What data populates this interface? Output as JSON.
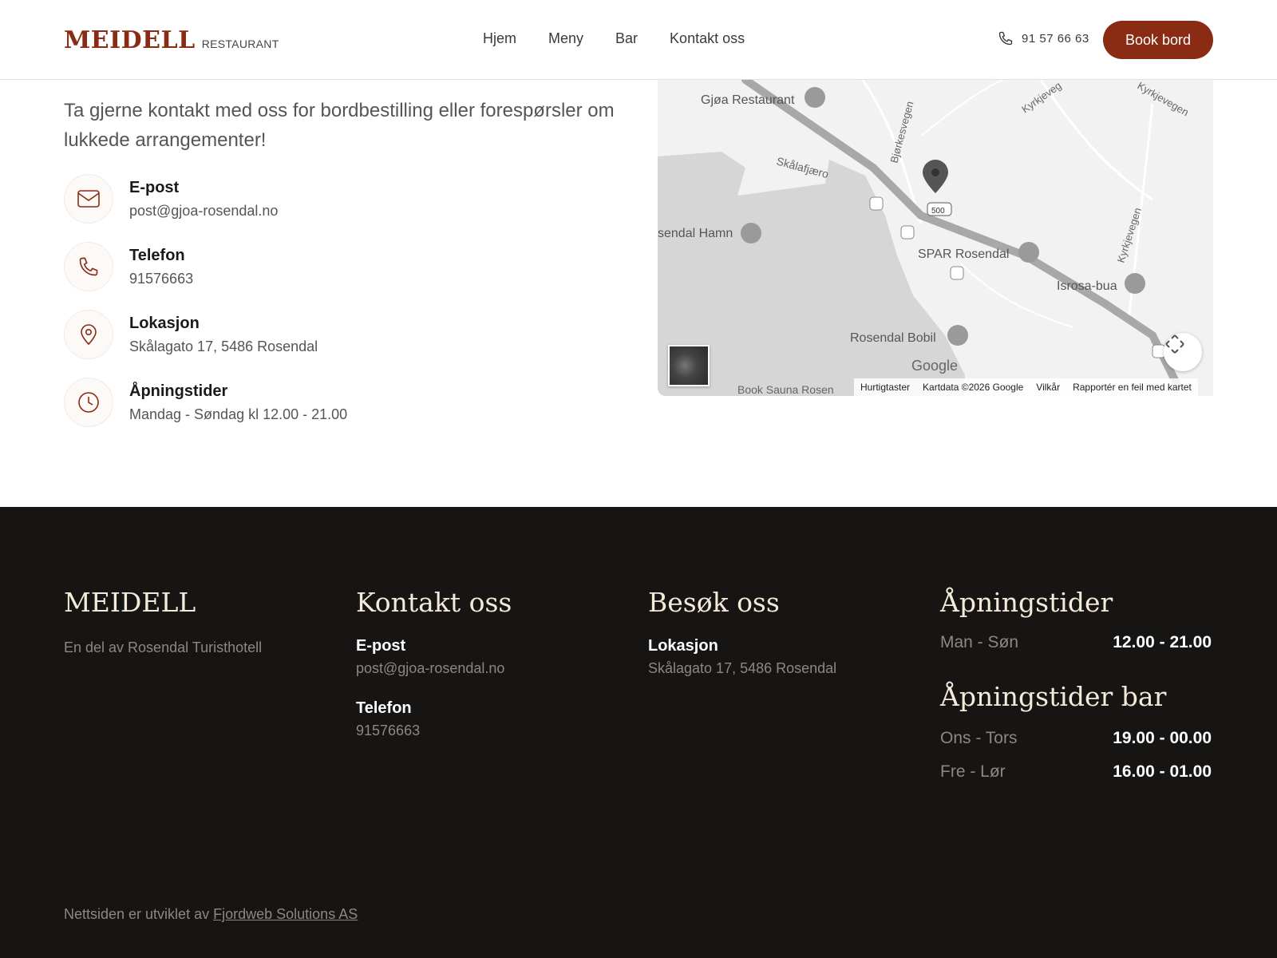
{
  "header": {
    "brand_name": "MEIDELL",
    "brand_sub": "RESTAURANT",
    "nav": [
      "Hjem",
      "Meny",
      "Bar",
      "Kontakt oss"
    ],
    "phone": "91 57 66 63",
    "book_label": "Book bord"
  },
  "contact": {
    "intro": "Ta gjerne kontakt med oss for bordbestilling eller forespørsler om lukkede arrangementer!",
    "items": [
      {
        "title": "E-post",
        "value": "post@gjoa-rosendal.no",
        "icon": "mail-icon"
      },
      {
        "title": "Telefon",
        "value": "91576663",
        "icon": "phone-icon"
      },
      {
        "title": "Lokasjon",
        "value": "Skålagato 17, 5486 Rosendal",
        "icon": "location-pin-icon"
      },
      {
        "title": "Åpningstider",
        "value": "Mandag - Søndag kl 12.00 - 21.00",
        "icon": "clock-icon"
      }
    ]
  },
  "map": {
    "labels": {
      "gjoa": "Gjøa Restaurant",
      "skalafjaero": "Skålafjæro",
      "bjorkesvegen": "Bjørkesvegen",
      "kyrkjevegen1": "Kyrkjeveg",
      "kyrkjevegen2": "Kyrkjevegen",
      "kyrkjevegen3": "Kyrkjevegen",
      "hamn": "sendal Hamn",
      "spar": "SPAR Rosendal",
      "isrosa": "Isrosa-bua",
      "bobil": "Rosendal Bobil",
      "road500": "500",
      "sauna": "Book Sauna Rosen",
      "google": "Google"
    },
    "footer": [
      "Hurtigtaster",
      "Kartdata ©2026 Google",
      "Vilkår",
      "Rapportér en feil med kartet"
    ]
  },
  "footer": {
    "brand": "MEIDELL",
    "tagline": "En del av Rosendal Turisthotell",
    "contact_head": "Kontakt oss",
    "email_label": "E-post",
    "email_value": "post@gjoa-rosendal.no",
    "phone_label": "Telefon",
    "phone_value": "91576663",
    "visit_head": "Besøk oss",
    "location_label": "Lokasjon",
    "location_value": "Skålagato 17, 5486 Rosendal",
    "hours_head": "Åpningstider",
    "hours": [
      {
        "day": "Man - Søn",
        "time": "12.00 - 21.00"
      }
    ],
    "bar_head": "Åpningstider bar",
    "bar_hours": [
      {
        "day": "Ons - Tors",
        "time": "19.00 - 00.00"
      },
      {
        "day": "Fre - Lør",
        "time": "16.00 - 01.00"
      }
    ],
    "credit_prefix": "Nettsiden er utviklet av",
    "credit_link": "Fjordweb Solutions AS"
  }
}
